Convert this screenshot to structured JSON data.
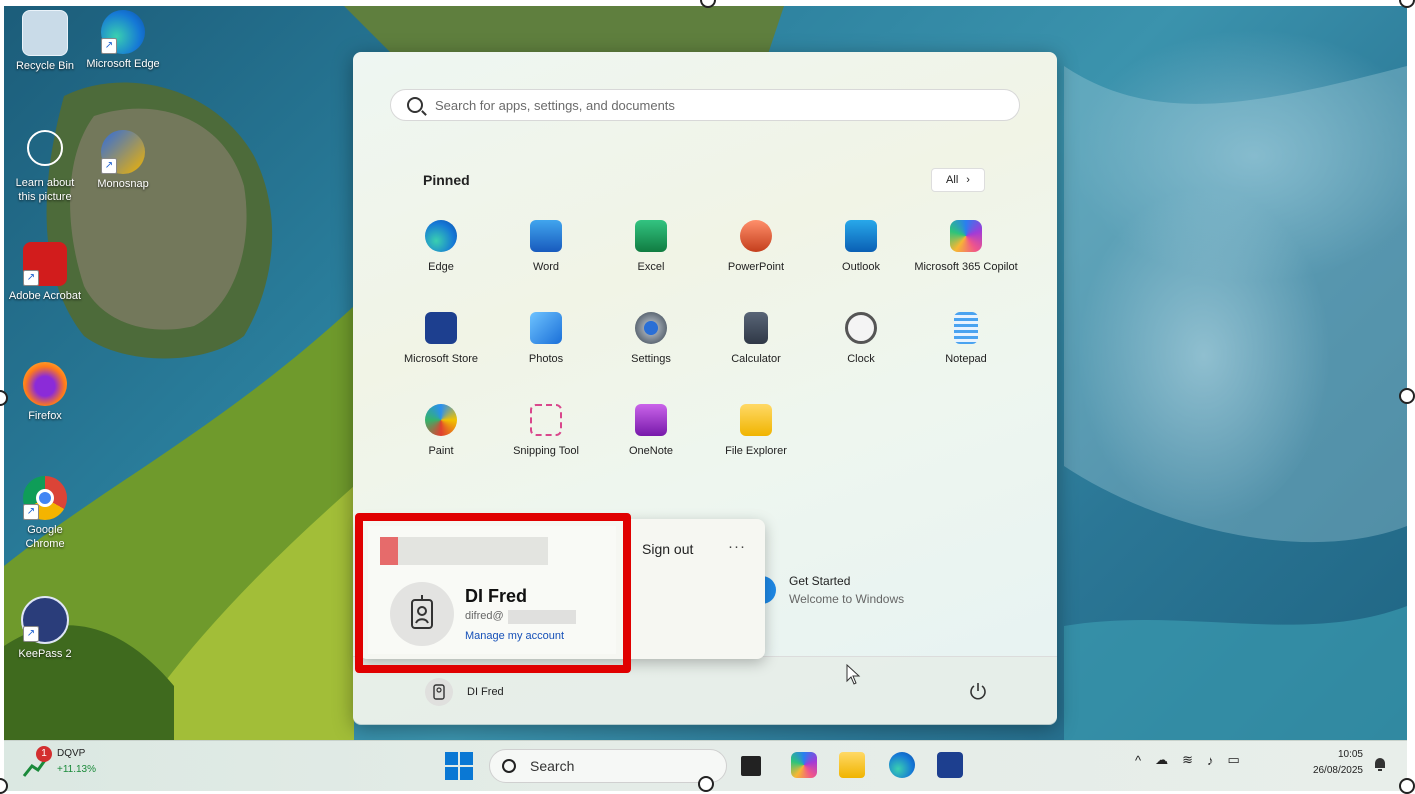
{
  "desktop": {
    "icons": [
      {
        "label": "Recycle Bin",
        "icon": "recycle-bin-icon"
      },
      {
        "label": "Microsoft Edge",
        "icon": "edge-icon"
      },
      {
        "label": "Learn about this picture",
        "icon": "camera-icon"
      },
      {
        "label": "Monosnap",
        "icon": "monosnap-icon"
      },
      {
        "label": "Adobe Acrobat",
        "icon": "acrobat-icon"
      },
      {
        "label": "Firefox",
        "icon": "firefox-icon"
      },
      {
        "label": "Google Chrome",
        "icon": "chrome-icon"
      },
      {
        "label": "KeePass 2",
        "icon": "keepass-icon"
      }
    ]
  },
  "start_menu": {
    "search_placeholder": "Search for apps, settings, and documents",
    "pinned_title": "Pinned",
    "all_button": "All",
    "pinned_apps": [
      {
        "label": "Edge",
        "icon": "edge-icon"
      },
      {
        "label": "Word",
        "icon": "word-icon"
      },
      {
        "label": "Excel",
        "icon": "excel-icon"
      },
      {
        "label": "PowerPoint",
        "icon": "powerpoint-icon"
      },
      {
        "label": "Outlook",
        "icon": "outlook-icon"
      },
      {
        "label": "Microsoft 365 Copilot",
        "icon": "copilot-icon"
      },
      {
        "label": "Microsoft Store",
        "icon": "store-icon"
      },
      {
        "label": "Photos",
        "icon": "photos-icon"
      },
      {
        "label": "Settings",
        "icon": "settings-icon"
      },
      {
        "label": "Calculator",
        "icon": "calculator-icon"
      },
      {
        "label": "Clock",
        "icon": "clock-icon"
      },
      {
        "label": "Notepad",
        "icon": "notepad-icon"
      },
      {
        "label": "Paint",
        "icon": "paint-icon"
      },
      {
        "label": "Snipping Tool",
        "icon": "snipping-tool-icon"
      },
      {
        "label": "OneNote",
        "icon": "onenote-icon"
      },
      {
        "label": "File Explorer",
        "icon": "file-explorer-icon"
      }
    ],
    "recommended": {
      "title": "Get Started",
      "subtitle": "Welcome to Windows"
    },
    "account_popup": {
      "user_name": "DI Fred",
      "email_prefix": "difred@",
      "manage_link": "Manage my account",
      "sign_out": "Sign out",
      "more": "···"
    },
    "footer": {
      "user_name": "DI Fred"
    }
  },
  "taskbar": {
    "stock": {
      "name": "DQVP",
      "change": "+11.13%",
      "badge": "1"
    },
    "search_label": "Search",
    "tray_icons": [
      "chevron-up-icon",
      "onedrive-icon",
      "wifi-icon",
      "volume-icon",
      "battery-icon"
    ],
    "clock_time": "10:05",
    "clock_date": "26/08/2025"
  },
  "colors": {
    "highlight": "#e00000",
    "link": "#1650b8",
    "stock_up": "#1a8a3a"
  }
}
